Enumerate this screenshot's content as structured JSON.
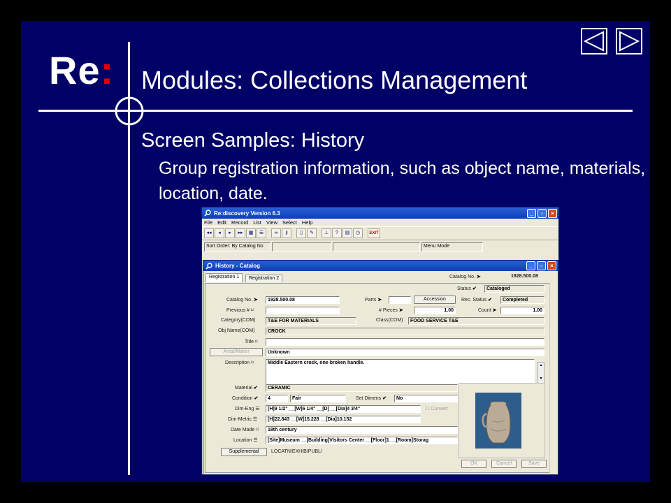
{
  "slide": {
    "brand": "Re",
    "brand_colon": ":",
    "title": "Modules: Collections Management",
    "subtitle": "Screen Samples:  History",
    "body": "Group registration information, such as object name, materials, location, date.",
    "colors": {
      "background": "#000066",
      "text": "#ffffff",
      "accent": "#e00000"
    },
    "nav": {
      "prev_icon": "triangle-left-icon",
      "next_icon": "triangle-right-icon"
    }
  },
  "app": {
    "title": "Re:discovery Version 6.3",
    "menu": [
      "File",
      "Edit",
      "Record",
      "List",
      "View",
      "Select",
      "Help"
    ],
    "toolbar": {
      "icons": [
        "first-record-icon",
        "prev-record-icon",
        "next-record-icon",
        "last-record-icon",
        "form-view-icon",
        "list-view-icon",
        "binoculars-icon",
        "key-icon",
        "new-record-icon",
        "edit-record-icon",
        "tree-icon",
        "help-icon",
        "calculator-icon",
        "clock-icon"
      ],
      "exit_label": "EXIT"
    },
    "sort_order": "Sort Order: By Catalog No",
    "menu_mode": "Menu Mode"
  },
  "child": {
    "title": "History - Catalog",
    "tabs": [
      "Registration 1",
      "Registration 2"
    ],
    "catalog_no_header_label": "Catalog No.",
    "catalog_no_header_value": "1928.500.08",
    "status_label": "Status",
    "status_value": "Cataloged",
    "rec_status_label": "Rec. Status",
    "rec_status_value": "Completed",
    "count_label": "Count",
    "count_value": "1.00",
    "parts_label": "Parts",
    "accession_label": "Accession",
    "pieces_label": "# Pieces",
    "pieces_value": "1.00",
    "class_label": "Class(COM)",
    "class_value": "FOOD SERVICE T&E",
    "fields": {
      "catalog_no_label": "Catalog No.",
      "catalog_no_value": "1928.500.08",
      "previous_label": "Previous #",
      "previous_value": "",
      "category_label": "Category(COM)",
      "category_value": "T&E FOR MATERIALS",
      "obj_name_label": "Obj Name(COM)",
      "obj_name_value": "CROCK",
      "title_label": "Title",
      "title_value": "",
      "artist_label": "Artist/Maker",
      "artist_value": "Unknown",
      "description_label": "Description",
      "description_value": "Middle Eastern crock, one broken handle.",
      "material_label": "Material",
      "material_value": "CERAMIC",
      "condition_label": "Condition",
      "condition_code": "4",
      "condition_value": "Fair",
      "set_dimens_label": "Set Dimens",
      "set_dimens_value": "No",
      "dim_eng_label": "Dim-Eng",
      "dim_eng_value": "[H]9 1/2\" __[W]6 1/4\" __[D] __[Dia]4 3/4\"",
      "dim_metric_label": "Dim-Metric",
      "dim_metric_value": "[H]22.843 __[W]15.228 __[Dia]10.152",
      "convert_label": "Convert",
      "date_made_label": "Date Made",
      "date_made_value": "18th century",
      "location_label": "Location",
      "location_value": "[Site]Museum __[Building]Visitors Center __[Floor]1 __[Room]Storag",
      "supplemental_label": "Supplemental",
      "supplemental_value": "LOCATN/EXHIB/PUBL/"
    },
    "buttons": {
      "ok": "OK",
      "cancel": "Cancel",
      "save": "Save"
    }
  }
}
